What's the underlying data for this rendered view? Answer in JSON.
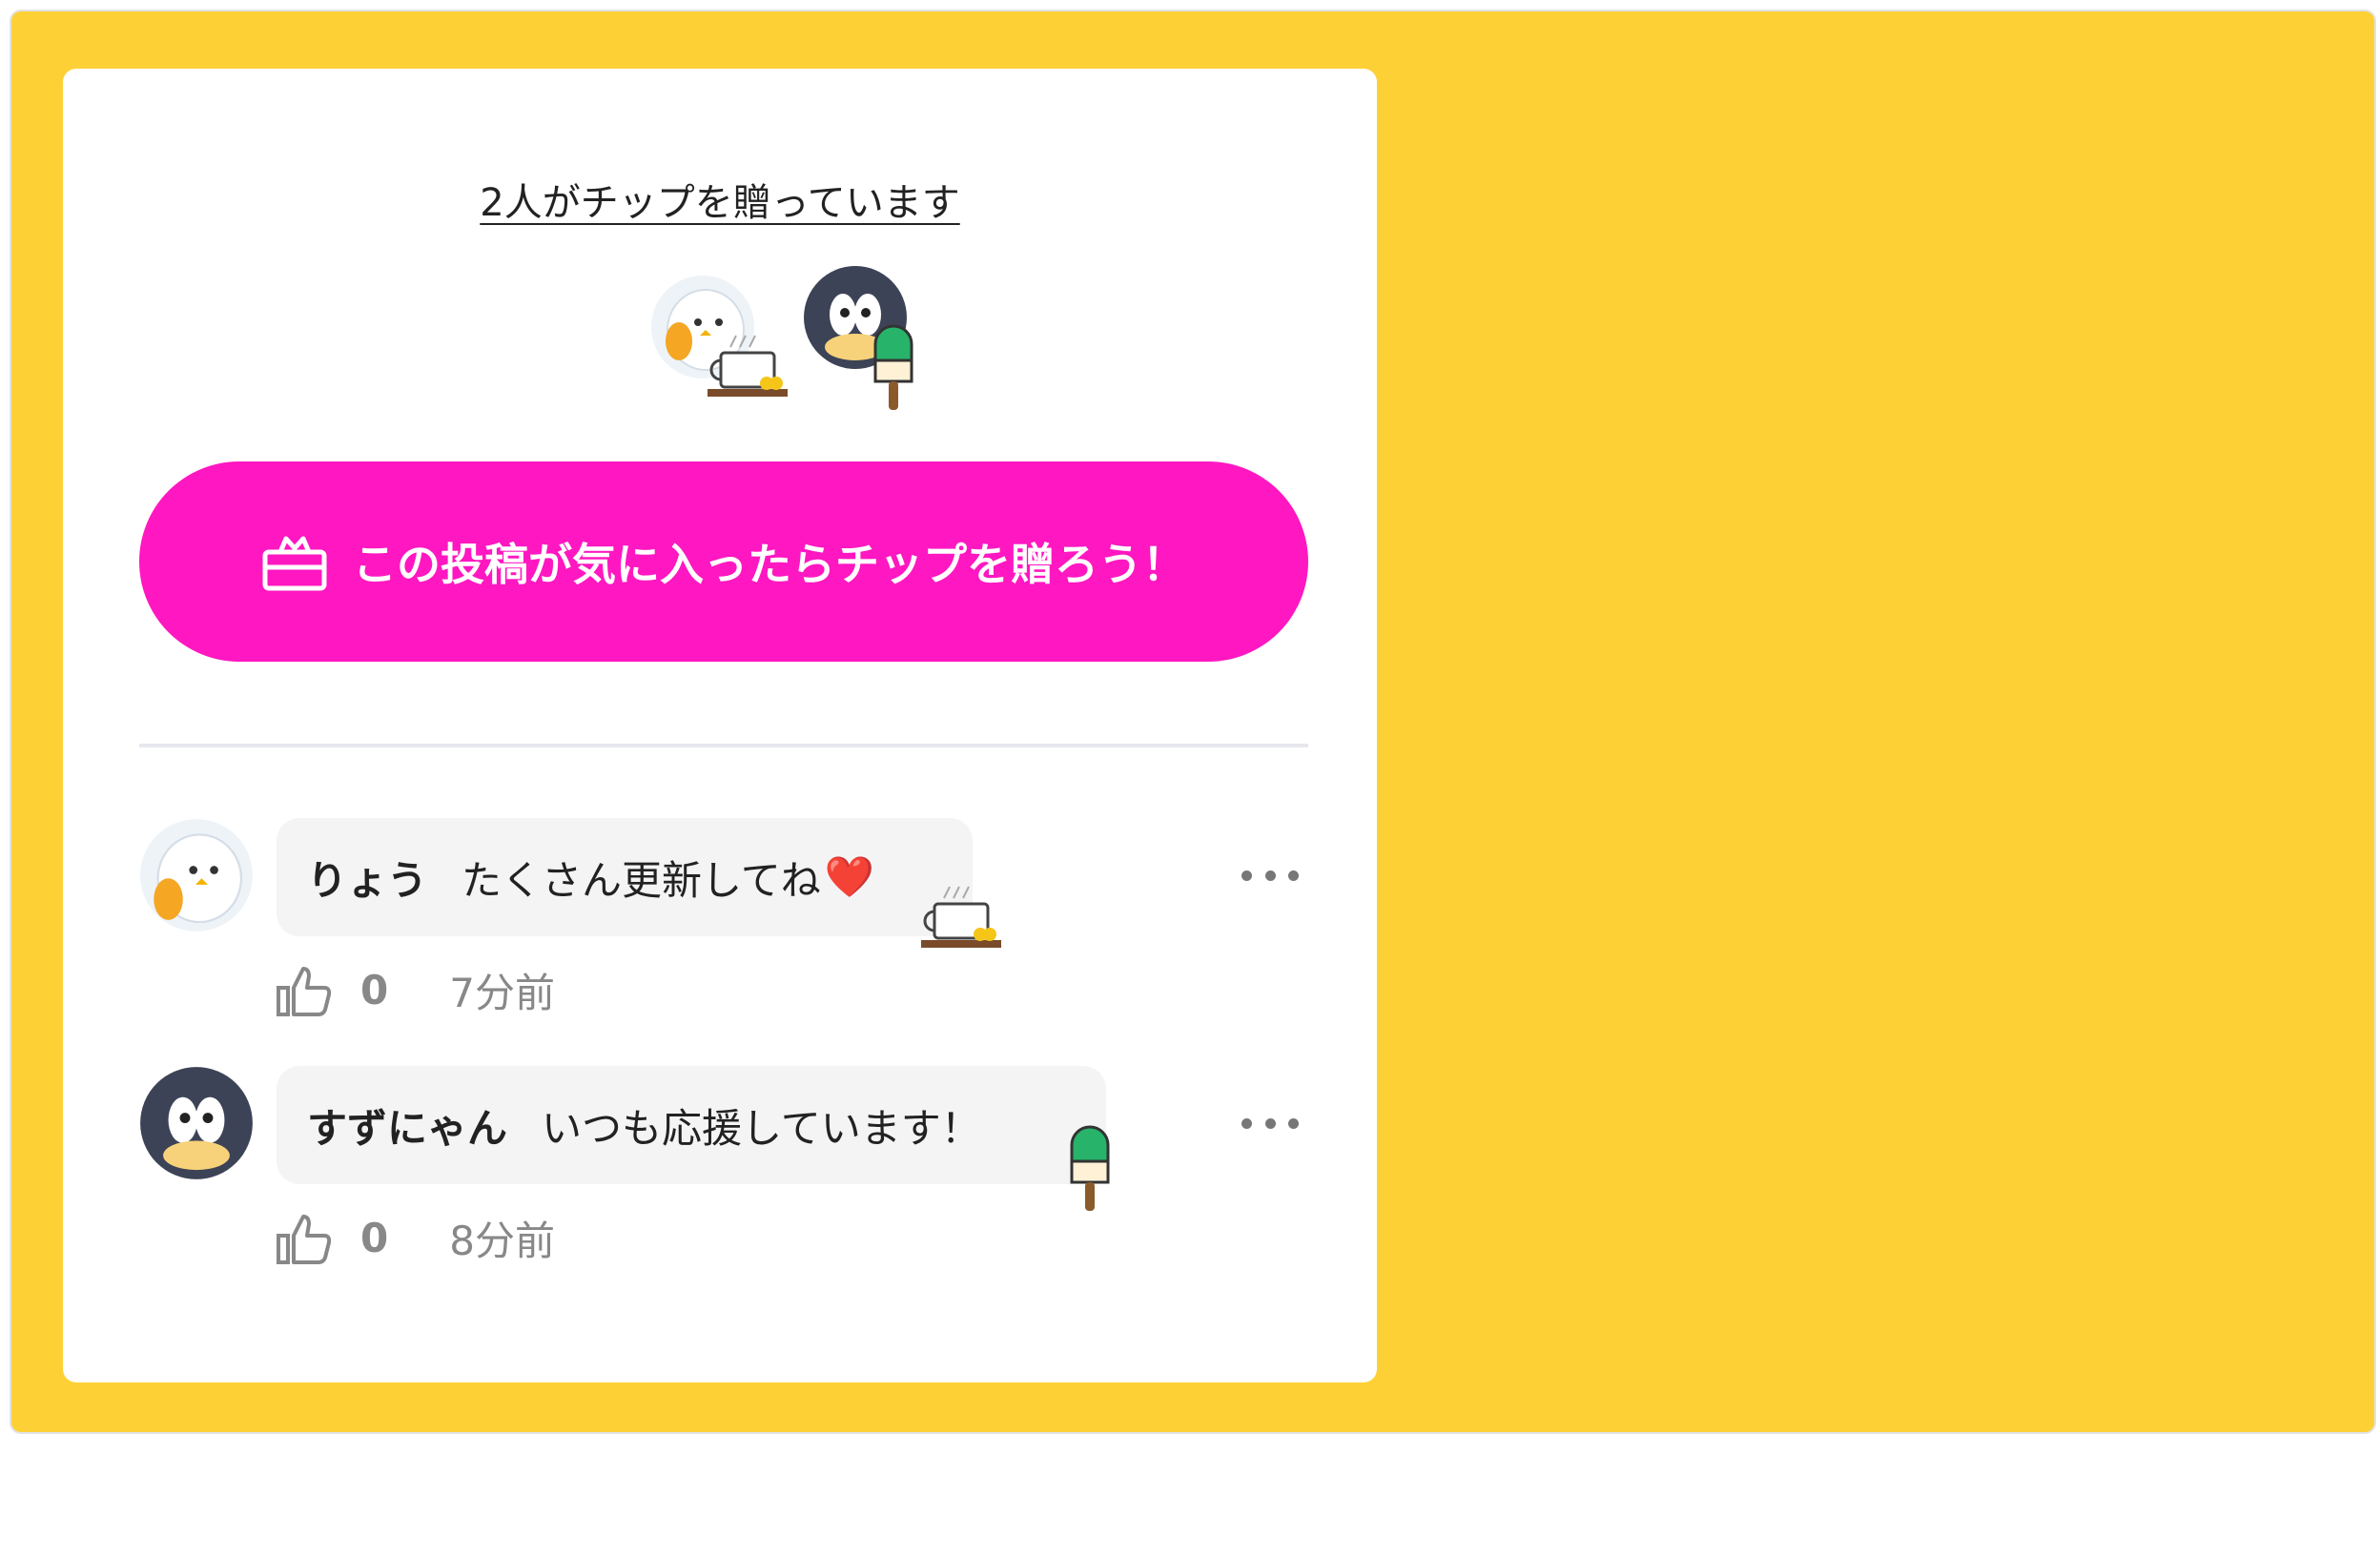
{
  "colors": {
    "background": "#FDD135",
    "card": "#ffffff",
    "cta": "#FF17C1",
    "bubble": "#f4f4f5"
  },
  "tips": {
    "summary_link": "2人がチップを贈っています",
    "avatars": [
      "bird-with-coffee-icon",
      "penguin-with-popsicle-icon"
    ]
  },
  "cta": {
    "label": "この投稿が気に入ったらチップを贈ろう！",
    "icon": "gift-icon"
  },
  "comments": [
    {
      "name": "りょう",
      "text": "たくさん更新してね",
      "emoji": "❤️",
      "likes": "0",
      "time": "7分前",
      "avatar": "bird-avatar-icon",
      "sticker": "coffee-sticker-icon"
    },
    {
      "name": "すずにゃん",
      "text": "いつも応援しています！",
      "likes": "0",
      "time": "8分前",
      "avatar": "penguin-avatar-icon",
      "sticker": "popsicle-sticker-icon"
    }
  ]
}
